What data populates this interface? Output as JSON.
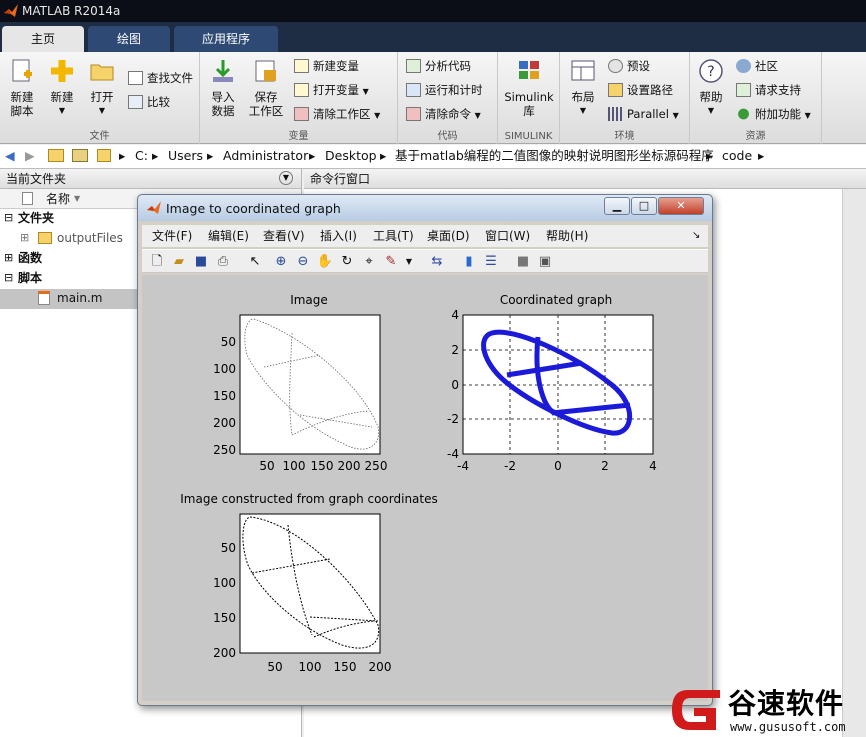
{
  "app": {
    "title": "MATLAB R2014a",
    "accent": "#1e2c44"
  },
  "tabs": [
    {
      "label": "主页"
    },
    {
      "label": "绘图"
    },
    {
      "label": "应用程序"
    }
  ],
  "ribbon": {
    "file": {
      "label": "文件",
      "new_script": "新建\n脚本",
      "new": "新建",
      "open": "打开",
      "find_files": "查找文件",
      "compare": "比较"
    },
    "variable": {
      "label": "变量",
      "import": "导入\n数据",
      "save_ws": "保存\n工作区",
      "new_var": "新建变量",
      "open_var": "打开变量",
      "clear_ws": "清除工作区"
    },
    "code": {
      "label": "代码",
      "analyze": "分析代码",
      "run_time": "运行和计时",
      "clear_cmd": "清除命令"
    },
    "simulink": {
      "label": "SIMULINK",
      "lib": "Simulink\n库"
    },
    "env": {
      "label": "环境",
      "layout": "布局",
      "prefs": "预设",
      "set_path": "设置路径",
      "parallel": "Parallel"
    },
    "resources": {
      "label": "资源",
      "help": "帮助",
      "community": "社区",
      "support": "请求支持",
      "addons": "附加功能"
    }
  },
  "address": {
    "segments": [
      "C:",
      "Users",
      "Administrator",
      "Desktop",
      "基于matlab编程的二值图像的映射说明图形坐标源码程序",
      "code"
    ]
  },
  "current_folder": {
    "title": "当前文件夹",
    "col_name": "名称",
    "groups": [
      {
        "label": "文件夹",
        "children": [
          {
            "label": "outputFiles"
          }
        ]
      },
      {
        "label": "函数",
        "children": []
      },
      {
        "label": "脚本",
        "children": [
          {
            "label": "main.m"
          }
        ]
      }
    ]
  },
  "command_window": {
    "title": "命令行窗口"
  },
  "figure": {
    "title": "Image to coordinated graph",
    "menu": [
      "文件(F)",
      "编辑(E)",
      "查看(V)",
      "插入(I)",
      "工具(T)",
      "桌面(D)",
      "窗口(W)",
      "帮助(H)"
    ],
    "plots": {
      "image": {
        "title": "Image",
        "yticks": [
          "50",
          "100",
          "150",
          "200",
          "250"
        ],
        "xticks": [
          "50",
          "100",
          "150",
          "200",
          "250"
        ]
      },
      "coord": {
        "title": "Coordinated graph",
        "yticks": [
          "4",
          "2",
          "0",
          "-2",
          "-4"
        ],
        "xticks": [
          "-4",
          "-2",
          "0",
          "2",
          "4"
        ]
      },
      "recon": {
        "title": "Image constructed from graph coordinates",
        "yticks": [
          "50",
          "100",
          "150",
          "200"
        ],
        "xticks": [
          "50",
          "100",
          "150",
          "200"
        ]
      }
    }
  },
  "watermark": {
    "brand": "谷速软件",
    "url": "www.gususoft.com",
    "color": "#d11a1a"
  }
}
